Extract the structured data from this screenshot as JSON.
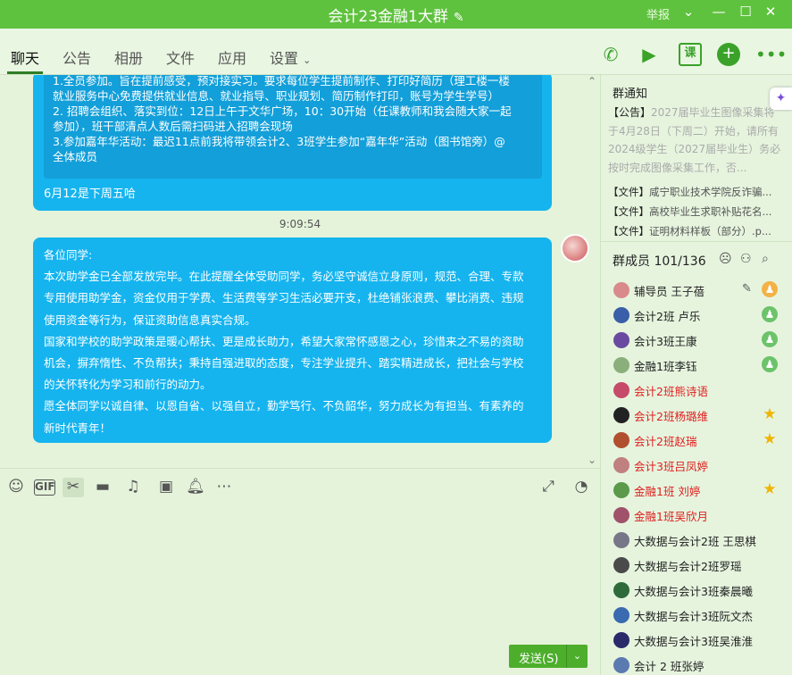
{
  "titlebar": {
    "title": "会计23金融1大群",
    "report": "举报",
    "colors": {
      "bg": "#5fc23e"
    }
  },
  "tabs": [
    {
      "label": "聊天"
    },
    {
      "label": "公告"
    },
    {
      "label": "相册"
    },
    {
      "label": "文件"
    },
    {
      "label": "应用"
    },
    {
      "label": "设置"
    }
  ],
  "toolbar_icons": [
    "phone-icon",
    "video-icon",
    "class-icon",
    "add-app-icon",
    "more-icon"
  ],
  "toolbar_class_label": "课",
  "chat": {
    "quote_lines": [
      "1.全员参加。旨在提前感受，预对接实习。要求每位学生提前制作、打印好简历（理工楼一楼",
      "就业服务中心免费提供就业信息、就业指导、职业规划、简历制作打印，账号为学生学号）",
      "2. 招聘会组织、落实到位：12日上午于文华广场，10：30开始（任课教师和我会随大家一起",
      "参加），班干部清点人数后需扫码进入招聘会现场",
      "3.参加嘉年华活动：最迟11点前我将带领会计2、3班学生参加“嘉年华”活动（图书馆旁）@",
      "全体成员"
    ],
    "message1_tail": "6月12是下周五哈",
    "time": "9:09:54",
    "message2": [
      "各位同学:",
      "本次助学金已全部发放完毕。在此提醒全体受助同学，务必坚守诚信立身原则，规范、合理、专款",
      "专用使用助学金，资金仅用于学费、生活费等学习生活必要开支，杜绝铺张浪费、攀比消费、违规",
      "使用资金等行为，保证资助信息真实合规。",
      "国家和学校的助学政策是暖心帮扶、更是成长助力，希望大家常怀感恩之心，珍惜来之不易的资助",
      "机会，摒弃惰性、不负帮扶；秉持自强进取的态度，专注学业提升、踏实精进成长，把社会与学校",
      "的关怀转化为学习和前行的动力。",
      "愿全体同学以诚自律、以恩自省、以强自立，勤学笃行、不负韶华，努力成长为有担当、有素养的",
      "新时代青年！"
    ]
  },
  "input_toolbar": {
    "gif_label": "GIF",
    "icons": [
      "emoji-icon",
      "gif-icon",
      "scissors-icon",
      "folder-icon",
      "music-icon",
      "image-icon",
      "bell-icon",
      "more-icon"
    ]
  },
  "send": {
    "label": "发送(S)"
  },
  "right": {
    "notice_title": "群通知",
    "notice_tag": "【公告】",
    "notice_text": "2027届毕业生图像采集将于4月28日（下周二）开始，请所有2024级学生（2027届毕业生）务必按时完成图像采集工作，否...",
    "files": [
      {
        "tag": "【文件】",
        "name": "咸宁职业技术学院反诈骗..."
      },
      {
        "tag": "【文件】",
        "name": "高校毕业生求职补贴花名..."
      },
      {
        "tag": "【文件】",
        "name": "证明材料样板（部分）.p..."
      }
    ],
    "members_title": "群成员 101/136",
    "members": [
      {
        "name": "辅导员 王子蓓",
        "red": false,
        "role": "owner",
        "edit": true,
        "avatar": "#d98a8a"
      },
      {
        "name": "会计2班 卢乐",
        "red": false,
        "role": "admin",
        "avatar": "#3a5fa8"
      },
      {
        "name": "会计3班王康",
        "red": false,
        "role": "admin",
        "avatar": "#6a4aa0"
      },
      {
        "name": "金融1班李钰",
        "red": false,
        "role": "admin",
        "avatar": "#8aaf7a"
      },
      {
        "name": "会计2班熊诗语",
        "red": true,
        "role": "",
        "avatar": "#c64a6a"
      },
      {
        "name": "会计2班杨璐维",
        "red": true,
        "role": "star",
        "avatar": "#222222"
      },
      {
        "name": "会计2班赵瑞",
        "red": true,
        "role": "star",
        "avatar": "#b0502e"
      },
      {
        "name": "会计3班吕凤婷",
        "red": true,
        "role": "",
        "avatar": "#c08080"
      },
      {
        "name": "金融1班 刘婷",
        "red": true,
        "role": "star",
        "avatar": "#5a9a4a"
      },
      {
        "name": "金融1班吴欣月",
        "red": true,
        "role": "",
        "avatar": "#a0526a"
      },
      {
        "name": "大数据与会计2班  王思棋",
        "red": false,
        "role": "",
        "avatar": "#777788"
      },
      {
        "name": "大数据与会计2班罗瑶",
        "red": false,
        "role": "",
        "avatar": "#4a4a4a"
      },
      {
        "name": "大数据与会计3班秦晨曦",
        "red": false,
        "role": "",
        "avatar": "#2f6a3a"
      },
      {
        "name": "大数据与会计3班阮文杰",
        "red": false,
        "role": "",
        "avatar": "#3a6ab0"
      },
      {
        "name": "大数据与会计3班吴淮淮",
        "red": false,
        "role": "",
        "avatar": "#2a2a6a"
      },
      {
        "name": "会计 2 班张婷",
        "red": false,
        "role": "",
        "avatar": "#5a7ab0"
      }
    ]
  }
}
